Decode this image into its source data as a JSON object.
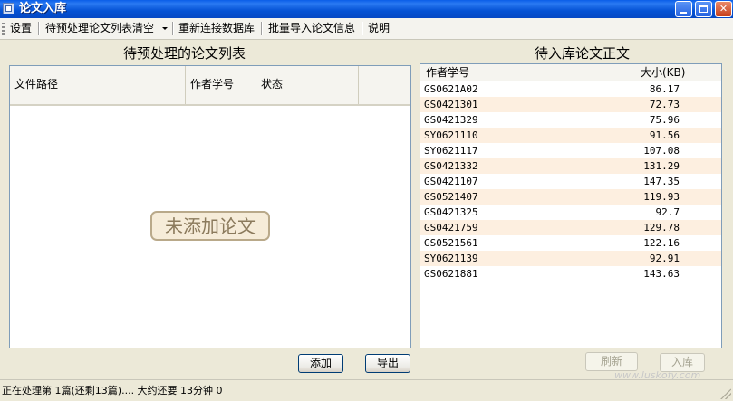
{
  "window": {
    "title": "论文入库"
  },
  "menu": {
    "settings": "设置",
    "clear_pending": "待预处理论文列表清空",
    "reconnect": "重新连接数据库",
    "batch_import": "批量导入论文信息",
    "help": "说明"
  },
  "left_panel": {
    "heading": "待预处理的论文列表",
    "columns": [
      "文件路径",
      "作者学号",
      "状态"
    ],
    "empty_text": "未添加论文",
    "add_button": "添加",
    "export_button": "导出"
  },
  "right_panel": {
    "heading": "待入库论文正文",
    "columns": [
      "作者学号",
      "大小(KB)"
    ],
    "rows": [
      [
        "GS0621A02",
        "86.17"
      ],
      [
        "GS0421301",
        "72.73"
      ],
      [
        "GS0421329",
        "75.96"
      ],
      [
        "SY0621110",
        "91.56"
      ],
      [
        "SY0621117",
        "107.08"
      ],
      [
        "GS0421332",
        "131.29"
      ],
      [
        "GS0421107",
        "147.35"
      ],
      [
        "GS0521407",
        "119.93"
      ],
      [
        "GS0421325",
        "92.7"
      ],
      [
        "GS0421759",
        "129.78"
      ],
      [
        "GS0521561",
        "122.16"
      ],
      [
        "SY0621139",
        "92.91"
      ],
      [
        "GS0621881",
        "143.63"
      ]
    ],
    "refresh_button": "刷新",
    "import_button": "入库"
  },
  "status": {
    "text": "正在处理第 1篇(还剩13篇).... 大约还要 13分钟 0"
  },
  "watermark": "www.luskofy.com",
  "colors": {
    "titlebar": "#0a5ee8",
    "row_alt": "#fdefe0",
    "note_border": "#b9a98a"
  }
}
